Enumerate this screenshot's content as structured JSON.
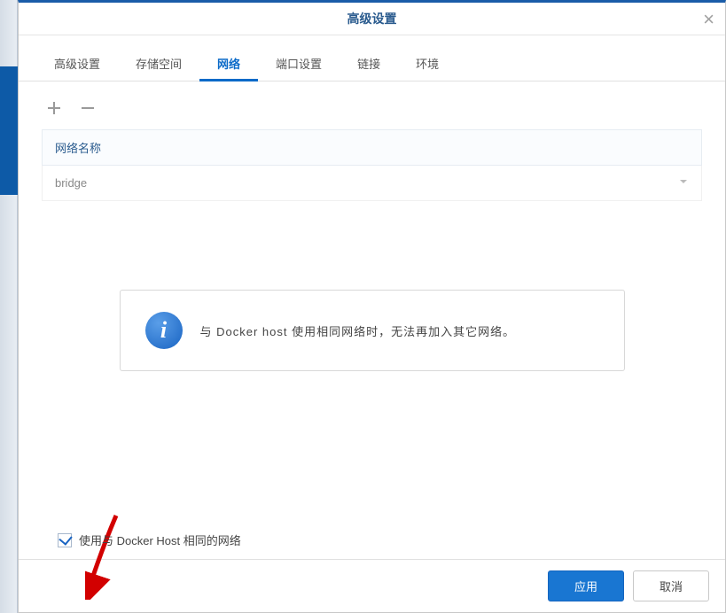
{
  "dialog": {
    "title": "高级设置"
  },
  "tabs": {
    "items": [
      {
        "label": "高级设置"
      },
      {
        "label": "存储空间"
      },
      {
        "label": "网络"
      },
      {
        "label": "端口设置"
      },
      {
        "label": "链接"
      },
      {
        "label": "环境"
      }
    ],
    "activeIndex": 2
  },
  "networkTable": {
    "header": "网络名称",
    "row0": "bridge"
  },
  "infoBox": {
    "text": "与 Docker host 使用相同网络时，无法再加入其它网络。"
  },
  "checkbox": {
    "label": "使用与 Docker Host 相同的网络",
    "checked": true
  },
  "footer": {
    "apply": "应用",
    "cancel": "取消"
  }
}
